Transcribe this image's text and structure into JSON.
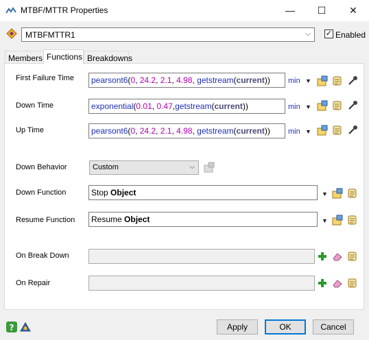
{
  "window": {
    "title": "MTBF/MTTR Properties",
    "minimize": "—",
    "maximize": "☐",
    "close": "✕"
  },
  "object": {
    "name": "MTBFMTTR1",
    "enabled_label": "Enabled",
    "enabled_checked": "✓"
  },
  "tabs": [
    {
      "label": "Members"
    },
    {
      "label": "Functions"
    },
    {
      "label": "Breakdowns"
    }
  ],
  "fields": {
    "first_failure": {
      "label": "First Failure Time",
      "fn": "pearsont6",
      "open": "(",
      "args": [
        "0",
        "24.2",
        "2.1",
        "4.98"
      ],
      "tail_fn": "getstream",
      "kw": "current",
      "units": "min"
    },
    "down_time": {
      "label": "Down Time",
      "fn": "exponential",
      "args": [
        "0.01",
        "0.47"
      ],
      "tail_fn": "getstream",
      "kw": "current",
      "units": "min"
    },
    "up_time": {
      "label": "Up Time",
      "fn": "pearsont6",
      "args": [
        "0",
        "24.2",
        "2.1",
        "4.98"
      ],
      "tail_fn": "getstream",
      "kw": "current",
      "units": "min"
    }
  },
  "down_behavior": {
    "label": "Down Behavior",
    "value": "Custom"
  },
  "down_function": {
    "label": "Down Function",
    "prefix": "Stop ",
    "bold": "Object"
  },
  "resume_function": {
    "label": "Resume Function",
    "prefix": "Resume ",
    "bold": "Object"
  },
  "on_break_down": {
    "label": "On Break Down",
    "value": ""
  },
  "on_repair": {
    "label": "On Repair",
    "value": ""
  },
  "buttons": {
    "apply": "Apply",
    "ok": "OK",
    "cancel": "Cancel"
  },
  "colors": {
    "function": "#1e2eb4",
    "number": "#b000b0",
    "accent": "#0078d7"
  }
}
